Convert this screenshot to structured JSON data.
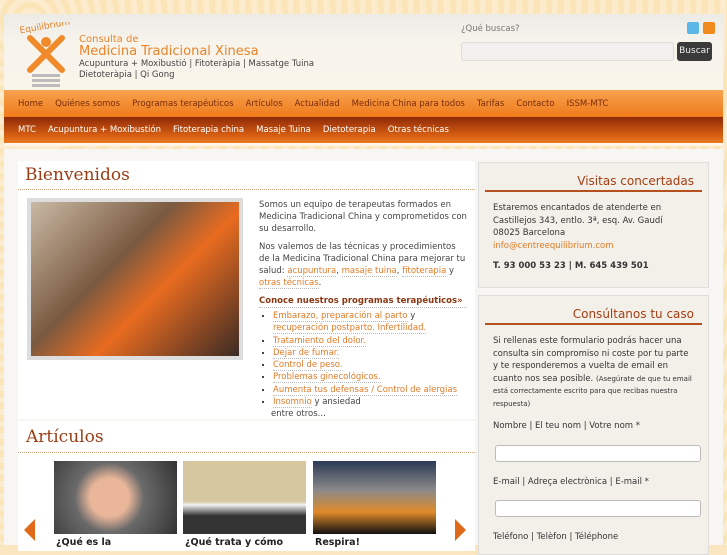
{
  "header": {
    "brand_line1": "Consulta de",
    "brand_line2": "Medicina Tradicional Xinesa",
    "brand_line3": "Acupuntura + Moxibustió | Fitoteràpia | Massatge Tuina",
    "brand_line4": "Dietoteràpia | Qi Gong",
    "logo_text": "Equilibrium",
    "search_label": "¿Qué buscas?",
    "search_placeholder": "",
    "search_button": "Buscar",
    "social": [
      "twitter-icon",
      "rss-icon"
    ]
  },
  "nav_primary": [
    "Home",
    "Quiénes somos",
    "Programas terapéuticos",
    "Artículos",
    "Actualidad",
    "Medicina China para todos",
    "Tarifas",
    "Contacto",
    "ISSM-MTC"
  ],
  "nav_secondary": [
    "MTC",
    "Acupuntura + Moxibustión",
    "Fitoterapia china",
    "Masaje Tuina",
    "Dietoterapia",
    "Otras técnicas"
  ],
  "welcome": {
    "title": "Bienvenidos",
    "p1": "Somos un equipo de terapeutas formados en Medicina Tradicional China y comprometidos con su desarrollo.",
    "p2": "Nos valemos de las técnicas y procedimientos de la Medicina Tradicional China para mejorar tu salud:",
    "links": [
      "acupuntura",
      ", ",
      "masaje tuina",
      ", ",
      "fitoterapia",
      " y ",
      "otras técnicas",
      "."
    ],
    "programs_link": "Conoce nuestros programas terapéuticos»",
    "list": [
      [
        "Embarazo, preparación al parto",
        " y ",
        "recuperación postparto. Infertilidad."
      ],
      [
        "Tratamiento del dolor."
      ],
      [
        "Dejar de fumar."
      ],
      [
        "Control de peso."
      ],
      [
        "Problemas ginecológicos."
      ],
      [
        "Aumenta tus defensas / Control de alergias"
      ],
      [
        "Insomnio",
        " y ansiedad"
      ]
    ],
    "other": "entre otros..."
  },
  "articles": {
    "title": "Artículos",
    "items": [
      "¿Qué es la",
      "¿Qué trata y cómo",
      "Respira!"
    ]
  },
  "visits": {
    "title": "Visitas concertadas",
    "l1": "Estaremos encantados de atenderte en",
    "l2": "Castillejos 343, entlo. 3ª, esq. Av. Gaudí",
    "l3": "08025 Barcelona",
    "email": "info@centreequilibrium.com",
    "phones": "T. 93 000 53 23 | M. 645 439 501"
  },
  "contact": {
    "title": "Consúltanos tu caso",
    "intro": "Si rellenas este formulario podrás hacer una consulta sin compromiso ni coste por tu parte y te responderemos a vuelta de email en cuanto nos sea posible.",
    "note": "(Asegúrate de que tu email está correctamente escrito para que recibas nuestra respuesta)",
    "name_label": "Nombre | El teu nom | Votre nom *",
    "email_label": "E-mail | Adreça electrònica | E-mail *",
    "phone_label": "Teléfono | Telèfon | Téléphone"
  },
  "colors": {
    "accent": "#e8842a",
    "nav": "#ef7a1a",
    "nav_dark": "#8e2a08",
    "heading": "#9a3d14"
  }
}
